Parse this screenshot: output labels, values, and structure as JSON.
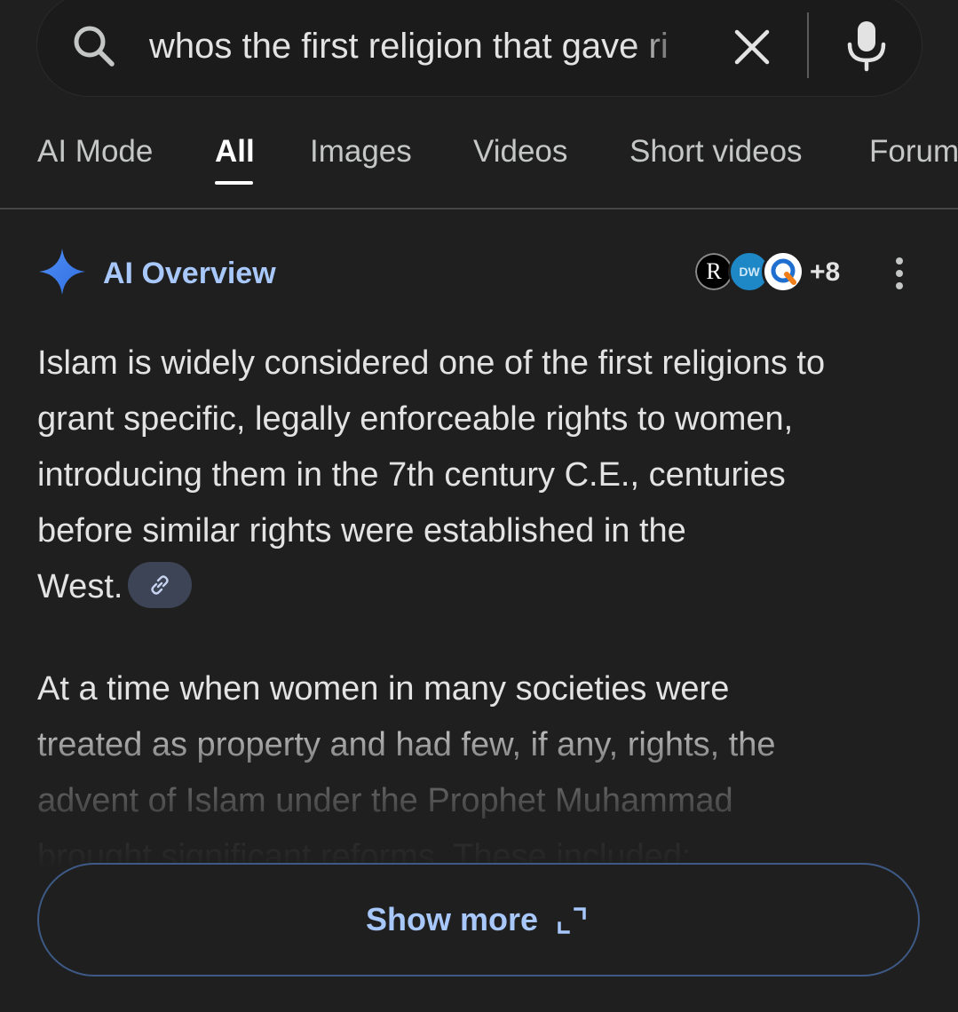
{
  "search": {
    "query": "whos the first religion that gave ri",
    "icons": [
      "search-icon",
      "clear-icon",
      "mic-icon"
    ]
  },
  "tabs": [
    {
      "label": "AI Mode",
      "active": false
    },
    {
      "label": "All",
      "active": true
    },
    {
      "label": "Images",
      "active": false
    },
    {
      "label": "Videos",
      "active": false
    },
    {
      "label": "Short videos",
      "active": false
    },
    {
      "label": "Forum",
      "active": false
    }
  ],
  "ai_overview": {
    "title": "AI Overview",
    "sources": [
      {
        "icon": "r-source-icon",
        "text": "R"
      },
      {
        "icon": "dw-source-icon",
        "text": "DW"
      },
      {
        "icon": "q-source-icon",
        "text": ""
      }
    ],
    "more_sources": "+8",
    "paragraph1_lines": [
      "Islam is widely considered one of the first religions to",
      "grant specific, legally enforceable rights to women,",
      "introducing them in the 7th century C.E., centuries",
      "before similar rights were established in the",
      "West."
    ],
    "paragraph2_lines": [
      "At a time when women in many societies were",
      "treated as property and had few, if any, rights, the",
      "advent of Islam under the Prophet Muhammad",
      "brought significant reforms. These included:"
    ]
  },
  "show_more": {
    "label": "Show more"
  },
  "colors": {
    "background": "#1f1f1f",
    "accent": "#a8c7fa",
    "text": "#e3e3e3",
    "chip": "#3c4456",
    "border": "#3d5a86"
  }
}
